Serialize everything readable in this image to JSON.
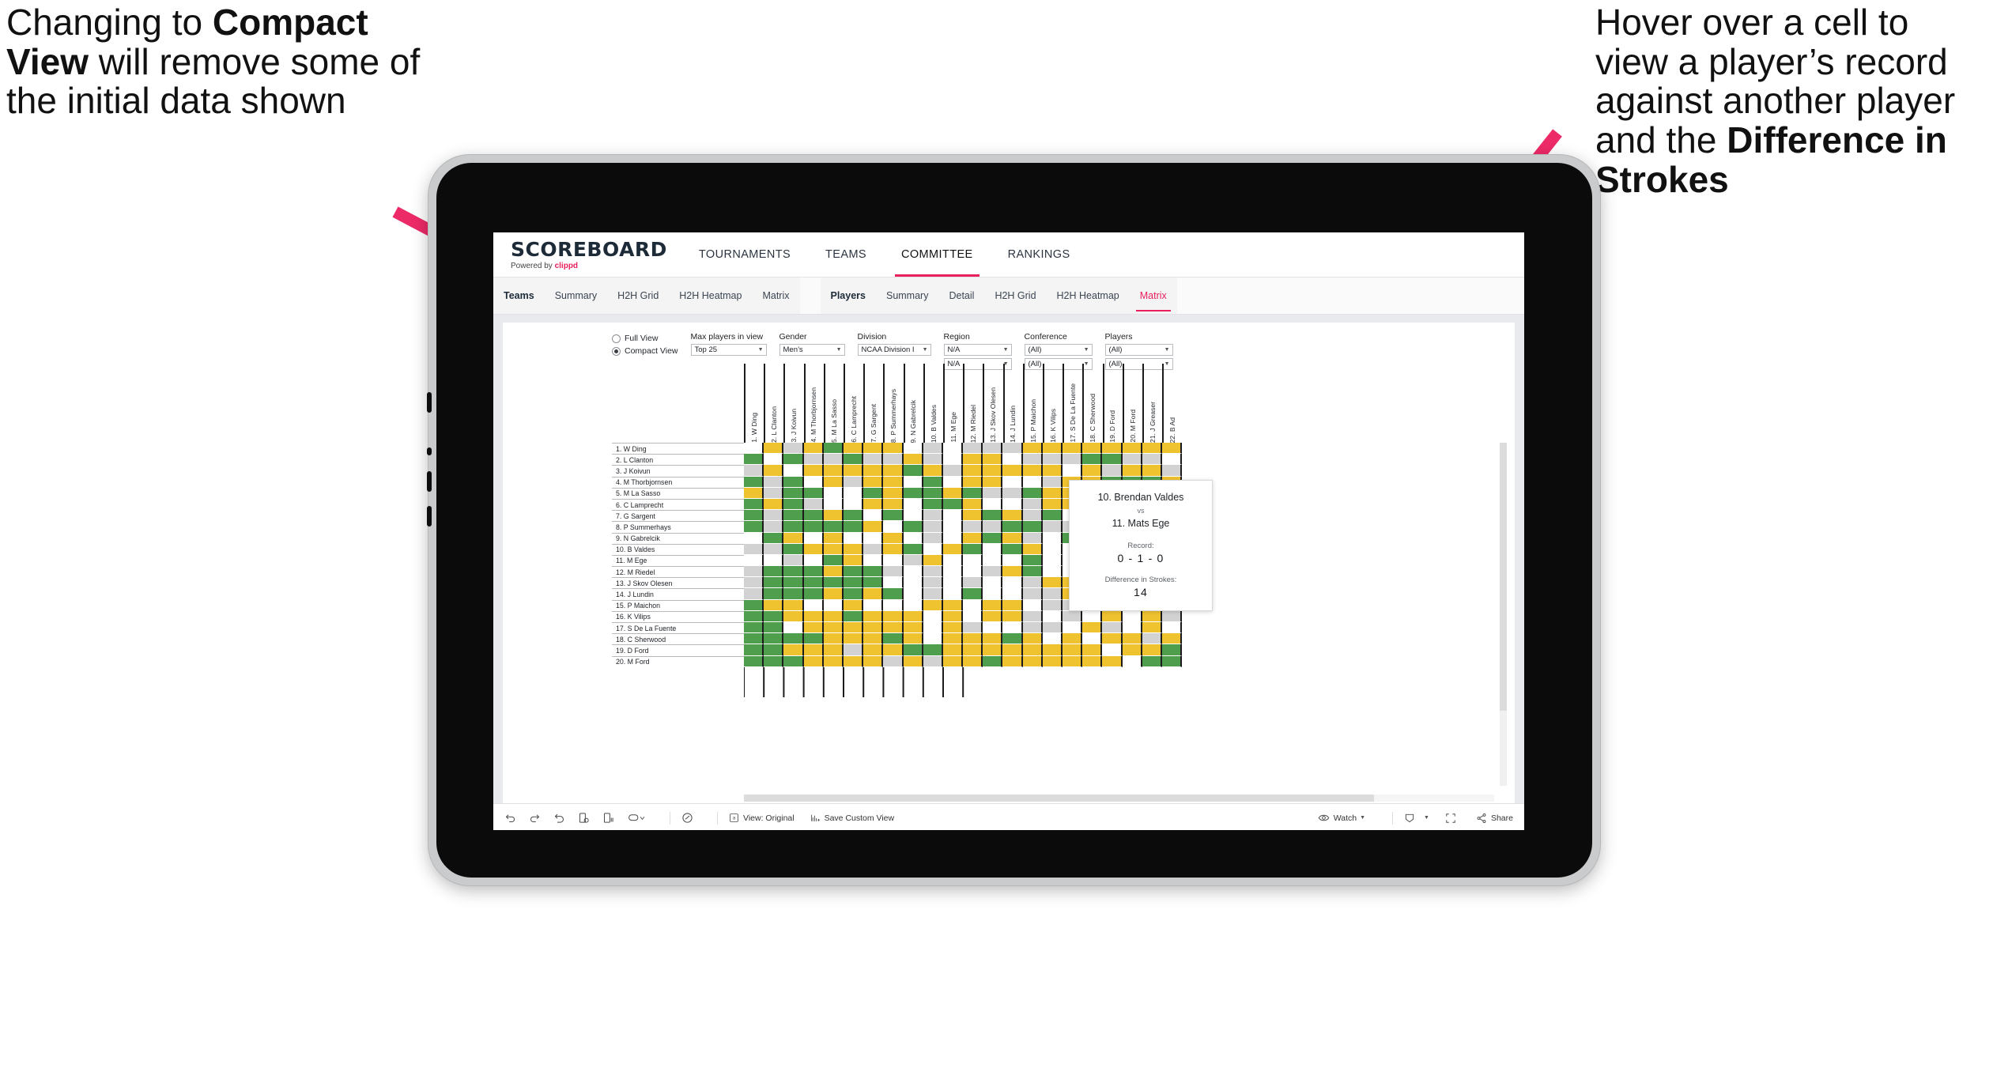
{
  "annotations": {
    "left": {
      "part1": "Changing to ",
      "bold": "Compact View",
      "part2": " will remove some of the initial data shown"
    },
    "right": {
      "part1": "Hover over a cell to view a player’s record against another player and the ",
      "bold": "Difference in Strokes"
    },
    "arrow_color": "#ED2A68"
  },
  "app": {
    "logo": {
      "title": "SCOREBOARD",
      "powered_prefix": "Powered by ",
      "brand": "clippd"
    },
    "nav": [
      {
        "label": "TOURNAMENTS",
        "active": false
      },
      {
        "label": "TEAMS",
        "active": false
      },
      {
        "label": "COMMITTEE",
        "active": true
      },
      {
        "label": "RANKINGS",
        "active": false
      }
    ],
    "subnav": {
      "teams_group": [
        {
          "label": "Teams",
          "head": true
        },
        {
          "label": "Summary"
        },
        {
          "label": "H2H Grid"
        },
        {
          "label": "H2H Heatmap"
        },
        {
          "label": "Matrix"
        }
      ],
      "players_group": [
        {
          "label": "Players",
          "head": true
        },
        {
          "label": "Summary"
        },
        {
          "label": "Detail"
        },
        {
          "label": "H2H Grid"
        },
        {
          "label": "H2H Heatmap"
        },
        {
          "label": "Matrix",
          "selected": true
        }
      ]
    }
  },
  "filters": {
    "view_mode": {
      "options": [
        "Full View",
        "Compact View"
      ],
      "selected": "Compact View"
    },
    "max_players": {
      "label": "Max players in view",
      "value": "Top 25"
    },
    "gender": {
      "label": "Gender",
      "value": "Men’s"
    },
    "division": {
      "label": "Division",
      "value": "NCAA Division I"
    },
    "region": {
      "label": "Region",
      "value": "N/A",
      "value2": "N/A"
    },
    "conference": {
      "label": "Conference",
      "value": "(All)",
      "value2": "(All)"
    },
    "players": {
      "label": "Players",
      "value": "(All)",
      "value2": "(All)"
    }
  },
  "matrix": {
    "row_labels": [
      "1. W Ding",
      "2. L Clanton",
      "3. J Koivun",
      "4. M Thorbjornsen",
      "5. M La Sasso",
      "6. C Lamprecht",
      "7. G Sargent",
      "8. P Summerhays",
      "9. N Gabrelcik",
      "10. B Valdes",
      "11. M Ege",
      "12. M Riedel",
      "13. J Skov Olesen",
      "14. J Lundin",
      "15. P Maichon",
      "16. K Vilips",
      "17. S De La Fuente",
      "18. C Sherwood",
      "19. D Ford",
      "20. M Ford"
    ],
    "col_labels": [
      "1. W Ding",
      "2. L Clanton",
      "3. J Koivun",
      "4. M Thorbjornsen",
      "5. M La Sasso",
      "6. C Lamprecht",
      "7. G Sargent",
      "8. P Summerhays",
      "9. N Gabrelcik",
      "10. B Valdes",
      "11. M Ege",
      "12. M Riedel",
      "13. J Skov Olesen",
      "14. J Lundin",
      "15. P Maichon",
      "16. K Vilips",
      "17. S De La Fuente",
      "18. C Sherwood",
      "19. D Ford",
      "20. M Ford",
      "21. J Greaser",
      "22. B Ad"
    ],
    "legend_colors": {
      "win": "#4E9E4E",
      "tie": "#EFC230",
      "loss": "#D2D2D2",
      "none": "#FFFFFF"
    },
    "cells": [
      [
        "n",
        "y",
        "g",
        "y",
        "v",
        "y",
        "y",
        "y",
        "n",
        "g",
        "n",
        "g",
        "g",
        "g",
        "y",
        "y",
        "y",
        "y",
        "y",
        "y",
        "y",
        "y"
      ],
      [
        "v",
        "n",
        "v",
        "g",
        "g",
        "v",
        "g",
        "g",
        "y",
        "g",
        "n",
        "y",
        "y",
        "n",
        "g",
        "g",
        "g",
        "v",
        "v",
        "g",
        "g",
        "n"
      ],
      [
        "g",
        "y",
        "n",
        "y",
        "y",
        "y",
        "y",
        "y",
        "v",
        "y",
        "g",
        "y",
        "y",
        "y",
        "y",
        "y",
        "n",
        "y",
        "g",
        "y",
        "y",
        "g"
      ],
      [
        "v",
        "g",
        "v",
        "n",
        "y",
        "g",
        "y",
        "y",
        "n",
        "v",
        "n",
        "y",
        "y",
        "n",
        "n",
        "g",
        "y",
        "y",
        "v",
        "v",
        "v",
        "y"
      ],
      [
        "y",
        "g",
        "v",
        "v",
        "n",
        "n",
        "v",
        "y",
        "v",
        "v",
        "y",
        "v",
        "g",
        "g",
        "v",
        "y",
        "y",
        "n",
        "g",
        "n",
        "n",
        "v"
      ],
      [
        "v",
        "y",
        "v",
        "g",
        "n",
        "n",
        "y",
        "y",
        "n",
        "v",
        "v",
        "y",
        "n",
        "n",
        "g",
        "y",
        "y",
        "y",
        "y",
        "y",
        "g",
        "v"
      ],
      [
        "v",
        "g",
        "v",
        "v",
        "y",
        "v",
        "n",
        "v",
        "n",
        "g",
        "n",
        "y",
        "v",
        "y",
        "g",
        "v",
        "n",
        "v",
        "v",
        "y",
        "g",
        "g"
      ],
      [
        "v",
        "g",
        "v",
        "v",
        "v",
        "v",
        "y",
        "n",
        "v",
        "g",
        "n",
        "g",
        "g",
        "v",
        "v",
        "g",
        "g",
        "v",
        "v",
        "v",
        "y",
        "v"
      ],
      [
        "n",
        "v",
        "y",
        "n",
        "y",
        "n",
        "n",
        "y",
        "n",
        "g",
        "n",
        "y",
        "v",
        "y",
        "g",
        "n",
        "v",
        "n",
        "v",
        "y",
        "y",
        "g"
      ],
      [
        "g",
        "g",
        "v",
        "y",
        "y",
        "y",
        "g",
        "y",
        "v",
        "n",
        "y",
        "v",
        "n",
        "v",
        "y",
        "n",
        "n",
        "y",
        "y",
        "g",
        "g",
        "y"
      ],
      [
        "n",
        "n",
        "g",
        "n",
        "v",
        "y",
        "n",
        "n",
        "g",
        "y",
        "n",
        "n",
        "n",
        "n",
        "v",
        "n",
        "n",
        "y",
        "y",
        "y",
        "y",
        "v"
      ],
      [
        "g",
        "v",
        "v",
        "v",
        "y",
        "v",
        "v",
        "g",
        "n",
        "g",
        "n",
        "n",
        "g",
        "y",
        "v",
        "n",
        "n",
        "g",
        "y",
        "y",
        "v",
        "y"
      ],
      [
        "g",
        "v",
        "v",
        "v",
        "v",
        "v",
        "v",
        "n",
        "n",
        "g",
        "n",
        "g",
        "n",
        "n",
        "g",
        "y",
        "y",
        "v",
        "g",
        "y",
        "y",
        "g"
      ],
      [
        "g",
        "v",
        "v",
        "v",
        "y",
        "v",
        "y",
        "v",
        "n",
        "g",
        "n",
        "v",
        "n",
        "n",
        "g",
        "g",
        "y",
        "n",
        "g",
        "v",
        "g",
        "v"
      ],
      [
        "v",
        "y",
        "y",
        "n",
        "n",
        "y",
        "n",
        "n",
        "n",
        "y",
        "y",
        "n",
        "y",
        "y",
        "n",
        "g",
        "g",
        "y",
        "y",
        "y",
        "y",
        "n"
      ],
      [
        "v",
        "v",
        "y",
        "y",
        "y",
        "v",
        "y",
        "y",
        "y",
        "n",
        "y",
        "n",
        "y",
        "y",
        "g",
        "n",
        "g",
        "n",
        "y",
        "n",
        "y",
        "g"
      ],
      [
        "v",
        "v",
        "n",
        "y",
        "y",
        "y",
        "y",
        "y",
        "y",
        "n",
        "y",
        "g",
        "n",
        "n",
        "g",
        "g",
        "n",
        "y",
        "g",
        "n",
        "y",
        "n"
      ],
      [
        "v",
        "v",
        "v",
        "v",
        "y",
        "y",
        "y",
        "v",
        "y",
        "n",
        "y",
        "y",
        "y",
        "v",
        "y",
        "n",
        "y",
        "n",
        "y",
        "y",
        "g",
        "y"
      ],
      [
        "v",
        "v",
        "y",
        "y",
        "y",
        "g",
        "y",
        "y",
        "v",
        "v",
        "y",
        "y",
        "y",
        "y",
        "y",
        "y",
        "y",
        "y",
        "n",
        "y",
        "y",
        "v"
      ],
      [
        "v",
        "v",
        "v",
        "y",
        "y",
        "y",
        "y",
        "g",
        "y",
        "g",
        "y",
        "y",
        "v",
        "y",
        "y",
        "y",
        "y",
        "y",
        "y",
        "n",
        "v",
        "v"
      ]
    ]
  },
  "tooltip": {
    "player_a": "10. Brendan Valdes",
    "vs": "vs",
    "player_b": "11. Mats Ege",
    "record_label": "Record:",
    "record_value": "0 - 1 - 0",
    "strokes_label": "Difference in Strokes:",
    "strokes_value": "14"
  },
  "toolbar": {
    "icons": [
      "undo-icon",
      "redo-icon",
      "revert-icon",
      "refresh-icon",
      "pause-icon",
      "zoom-icon"
    ],
    "help": "help-icon",
    "view_label": "View: Original",
    "save_label": "Save Custom View",
    "watch_label": "Watch",
    "download_label": "download-icon",
    "fullscreen_label": "fullscreen-icon",
    "share_label": "Share"
  }
}
